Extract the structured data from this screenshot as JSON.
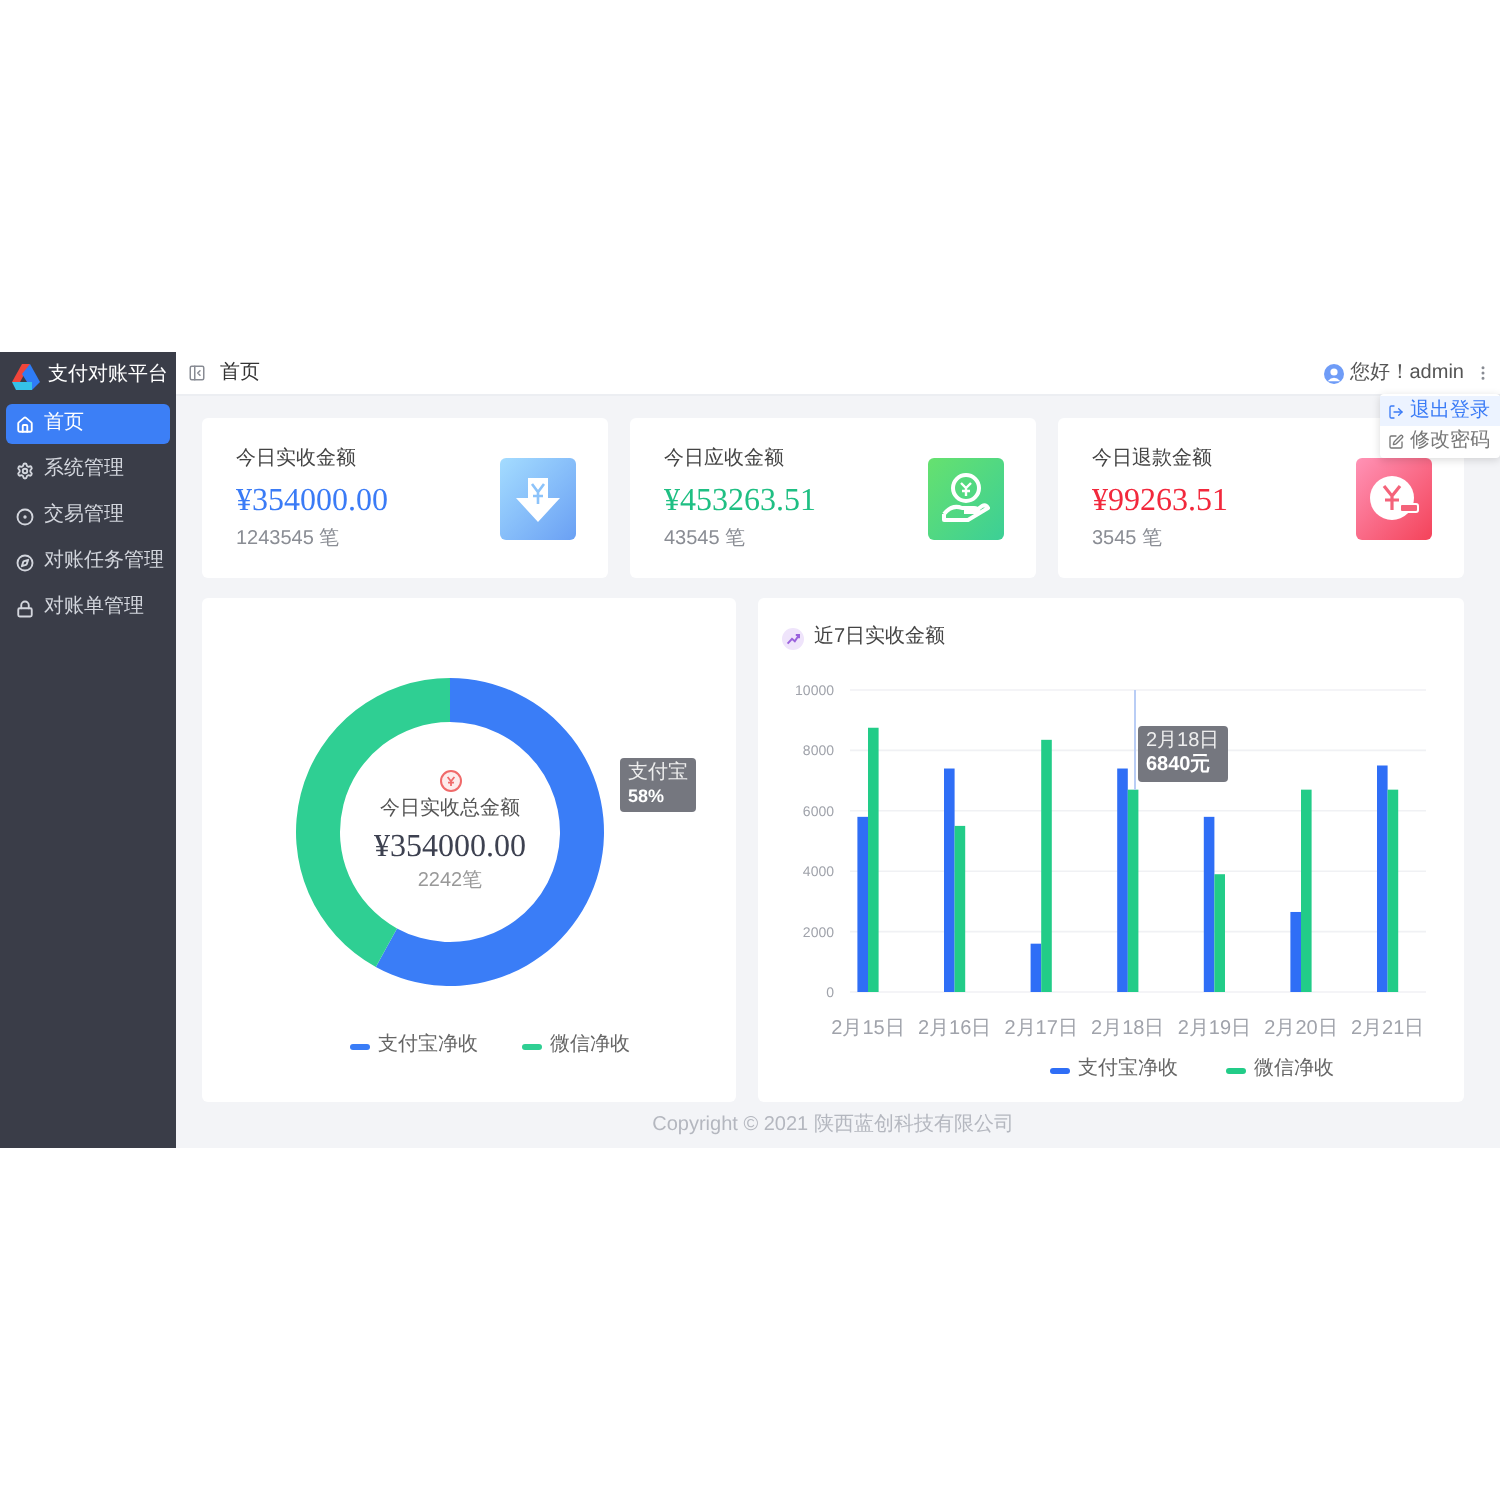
{
  "sidebar": {
    "logo_title": "支付对账平台",
    "items": [
      {
        "label": "首页",
        "selected": true
      },
      {
        "label": "系统管理",
        "selected": false
      },
      {
        "label": "交易管理",
        "selected": false
      },
      {
        "label": "对账任务管理",
        "selected": false
      },
      {
        "label": "对账单管理",
        "selected": false
      }
    ]
  },
  "header": {
    "breadcrumb": "首页",
    "greeting": "您好！admin"
  },
  "user_menu": {
    "items": [
      {
        "label": "退出登录",
        "selected": true
      },
      {
        "label": "修改密码",
        "selected": false
      }
    ]
  },
  "stat_cards": [
    {
      "kind": "received",
      "label": "今日实收金额",
      "amount": "¥354000.00",
      "count": "1243545 笔",
      "color": "#3a7bf6"
    },
    {
      "kind": "receivable",
      "label": "今日应收金额",
      "amount": "¥453263.51",
      "count": "43545 笔",
      "color": "#1fbf83"
    },
    {
      "kind": "refund",
      "label": "今日退款金额",
      "amount": "¥99263.51",
      "count": "3545 笔",
      "color": "#f2283c"
    }
  ],
  "donut_card": {
    "center_label": "今日实收总金额",
    "center_amount": "¥354000.00",
    "center_count": "2242笔",
    "tooltip": {
      "name": "支付宝",
      "value": "58%"
    },
    "legend": [
      {
        "color": "#3a7df7"
      },
      {
        "color": "#2fcf93"
      }
    ],
    "chart_data": {
      "type": "donut",
      "categories": [
        "支付宝净收",
        "微信净收"
      ],
      "values": [
        58,
        42
      ]
    }
  },
  "bar_card": {
    "tooltip": {
      "date": "2月18日",
      "value": "6840元"
    },
    "chart_data": {
      "type": "bar",
      "title": "近7日实收金额",
      "categories": [
        "2月15日",
        "2月16日",
        "2月17日",
        "2月18日",
        "2月19日",
        "2月20日",
        "2月21日"
      ],
      "series": [
        {
          "name": "支付宝净收",
          "color": "#2f6ef6",
          "values": [
            5800,
            7400,
            1600,
            7400,
            5800,
            2650,
            7500
          ]
        },
        {
          "name": "微信净收",
          "color": "#22cc88",
          "values": [
            8750,
            5500,
            8350,
            6700,
            3900,
            6700,
            6700
          ]
        }
      ],
      "ylim": [
        0,
        10000
      ],
      "yticks": [
        0,
        2000,
        4000,
        6000,
        8000,
        10000
      ],
      "grid": true
    }
  },
  "footer": "Copyright © 2021 陕西蓝创科技有限公司"
}
